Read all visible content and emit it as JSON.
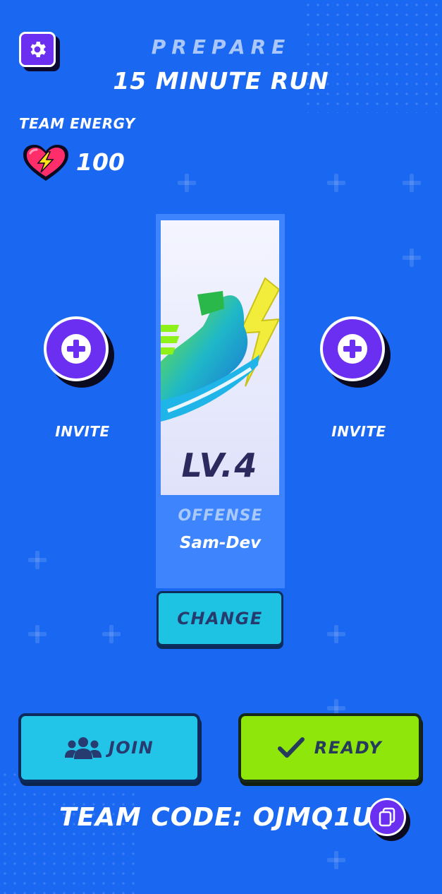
{
  "header": {
    "subtitle": "PREPARE",
    "title": "15 MINUTE RUN"
  },
  "energy": {
    "label": "TEAM ENERGY",
    "value": "100",
    "icon": "heart-lightning-icon"
  },
  "invite_slots": [
    {
      "label": "INVITE",
      "icon": "plus-icon"
    },
    {
      "label": "INVITE",
      "icon": "plus-icon"
    }
  ],
  "player_card": {
    "level": "LV.4",
    "role": "OFFENSE",
    "player_name": "Sam-Dev",
    "image": "lightning-sneaker-icon"
  },
  "buttons": {
    "change": "CHANGE",
    "join": "JOIN",
    "ready": "READY"
  },
  "team_code": {
    "text": "TEAM CODE: OJMQ1U"
  },
  "icons": {
    "settings": "gear-icon",
    "join": "group-icon",
    "ready": "checkmark-icon",
    "copy": "copy-icon"
  },
  "colors": {
    "background": "#1a68f2",
    "accent_purple": "#6a2ff0",
    "button_cyan": "#22c4e8",
    "button_green": "#8ee60a",
    "card_panel": "#3d84fd"
  }
}
